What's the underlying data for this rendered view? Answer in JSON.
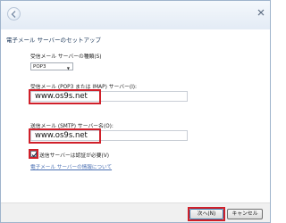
{
  "header": {
    "title": "電子メール サーバーのセットアップ"
  },
  "form": {
    "server_type_label": "受信メール サーバーの種類(S)",
    "server_type_value": "POP3",
    "incoming_label": "受信メール (POP3 または IMAP) サーバー(I):",
    "incoming_value": "www.os9s.net",
    "outgoing_label": "送信メール (SMTP) サーバー名(O):",
    "outgoing_value": "www.os9s.net",
    "auth_label": "送信サーバーは認証が必要(V)",
    "auth_checked": true,
    "info_link": "電子メール サーバーの情報について"
  },
  "footer": {
    "next_label": "次へ(N)",
    "cancel_label": "キャンセル"
  },
  "colors": {
    "highlight": "#d0202a",
    "heading": "#1e395b",
    "link": "#4a6fb3"
  }
}
